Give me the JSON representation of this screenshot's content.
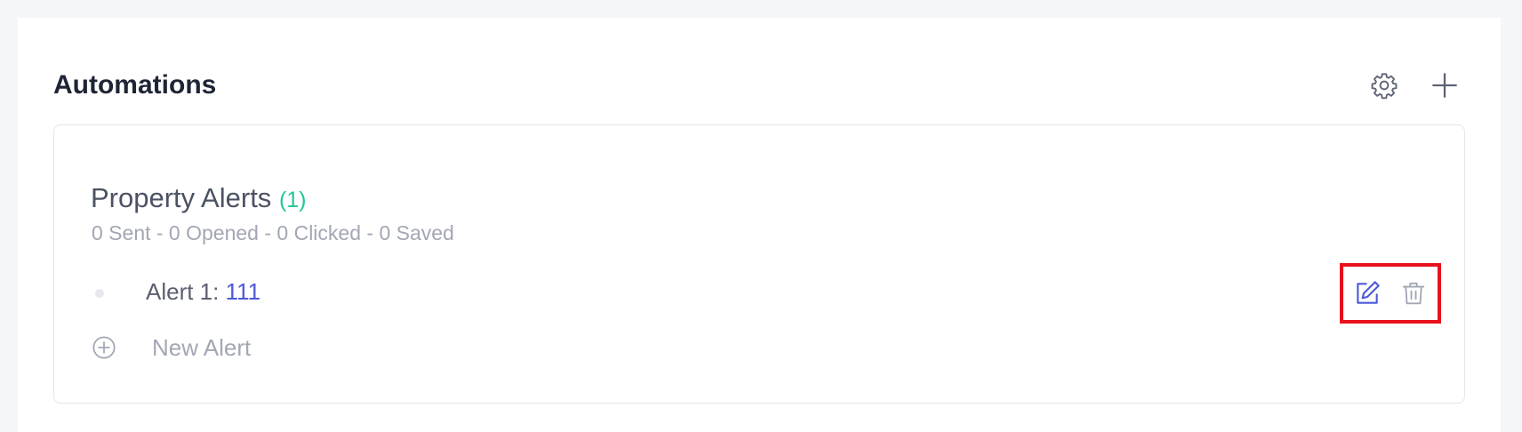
{
  "panel": {
    "title": "Automations",
    "settings_icon": "gear-icon",
    "add_icon": "plus-icon"
  },
  "group": {
    "title": "Property Alerts",
    "count": "(1)",
    "stats": "0 Sent - 0 Opened - 0 Clicked - 0 Saved",
    "alerts": [
      {
        "label": "Alert 1:",
        "value": "111",
        "edit_icon": "edit-icon",
        "delete_icon": "trash-icon"
      }
    ],
    "new_alert_label": "New Alert"
  },
  "colors": {
    "accent": "#4d5ad8",
    "count": "#1fc79a",
    "highlight": "#e8101c"
  }
}
